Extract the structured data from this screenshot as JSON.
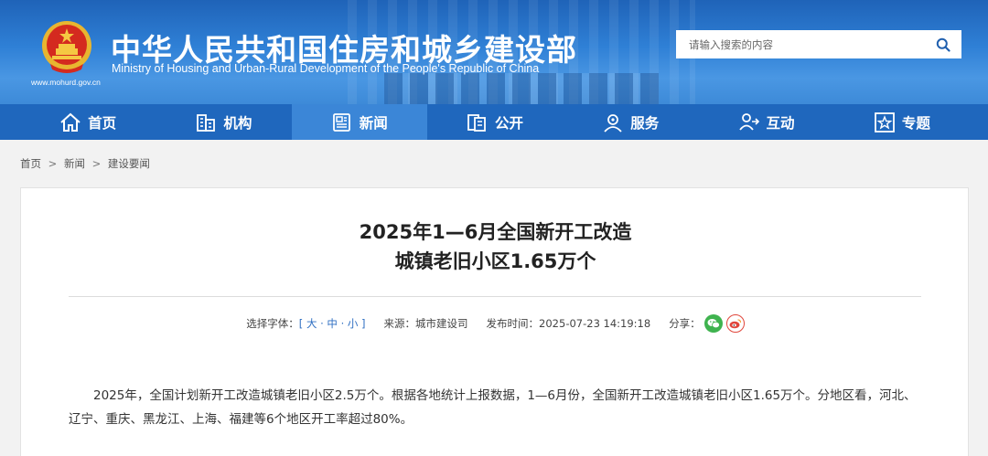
{
  "header": {
    "site_name_cn": "中华人民共和国住房和城乡建设部",
    "site_name_en": "Ministry of Housing and Urban-Rural Development of the People's Republic of China",
    "site_url": "www.mohurd.gov.cn",
    "search_placeholder": "请输入搜索的内容"
  },
  "nav": {
    "items": [
      {
        "label": "首页",
        "icon": "home-icon"
      },
      {
        "label": "机构",
        "icon": "building-icon"
      },
      {
        "label": "新闻",
        "icon": "newspaper-icon",
        "active": true
      },
      {
        "label": "公开",
        "icon": "document-icon"
      },
      {
        "label": "服务",
        "icon": "user-service-icon"
      },
      {
        "label": "互动",
        "icon": "interaction-icon"
      },
      {
        "label": "专题",
        "icon": "star-icon"
      }
    ]
  },
  "breadcrumb": {
    "items": [
      "首页",
      "新闻",
      "建设要闻"
    ],
    "separator": ">"
  },
  "article": {
    "title_line1": "2025年1—6月全国新开工改造",
    "title_line2": "城镇老旧小区1.65万个",
    "font_size_label": "选择字体：",
    "font_sizes": [
      "大",
      "中",
      "小"
    ],
    "source_label": "来源：",
    "source": "城市建设司",
    "publish_label": "发布时间：",
    "publish_time": "2025-07-23 14:19:18",
    "share_label": "分享：",
    "body": "2025年，全国计划新开工改造城镇老旧小区2.5万个。根据各地统计上报数据，1—6月份，全国新开工改造城镇老旧小区1.65万个。分地区看，河北、辽宁、重庆、黑龙江、上海、福建等6个地区开工率超过80%。"
  },
  "colors": {
    "header_blue": "#2f80d6",
    "nav_blue": "#1f67bd",
    "nav_active": "#3b86d7",
    "link_blue": "#2f6fc2",
    "wechat_green": "#3fb34f",
    "weibo_red": "#e0463b"
  }
}
